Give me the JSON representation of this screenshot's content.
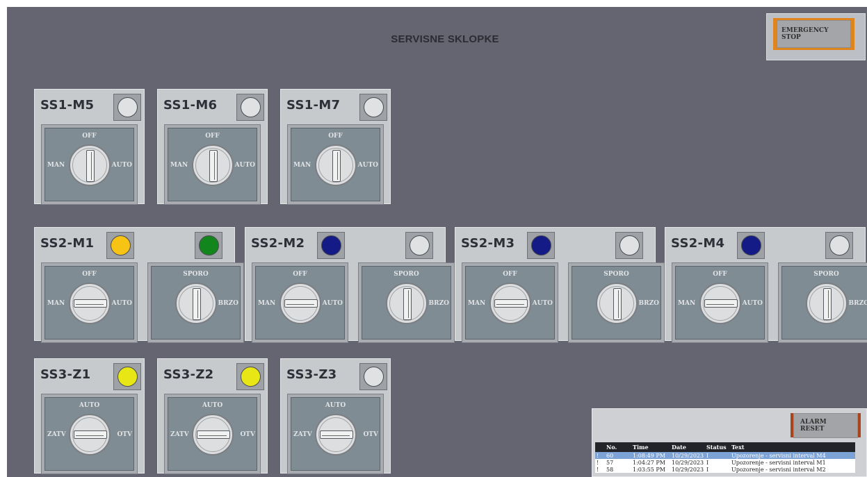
{
  "title": "SERVISNE SKLOPKE",
  "emergency_stop_label": "EMERGENCY STOP",
  "alarm_reset_label": "ALARM RESET",
  "colors": {
    "white_off": "#dfe1e2",
    "yellow_amber": "#f7c416",
    "yellow": "#e9e616",
    "green": "#13851d",
    "blue": "#141a86"
  },
  "row1": [
    {
      "name": "SS1-M5",
      "lamp": "#dfe1e2",
      "sw": {
        "top": "OFF",
        "left": "MAN",
        "right": "AUTO"
      }
    },
    {
      "name": "SS1-M6",
      "lamp": "#dfe1e2",
      "sw": {
        "top": "OFF",
        "left": "MAN",
        "right": "AUTO"
      }
    },
    {
      "name": "SS1-M7",
      "lamp": "#dfe1e2",
      "sw": {
        "top": "OFF",
        "left": "MAN",
        "right": "AUTO"
      }
    }
  ],
  "row2": [
    {
      "name": "SS2-M1",
      "lamp1": "#f7c416",
      "lamp2": "#13851d",
      "sw1": {
        "top": "OFF",
        "left": "MAN",
        "right": "AUTO"
      },
      "sw2": {
        "top": "SPORO",
        "right": "BRZO"
      }
    },
    {
      "name": "SS2-M2",
      "lamp1": "#141a86",
      "lamp2": "#dfe1e2",
      "sw1": {
        "top": "OFF",
        "left": "MAN",
        "right": "AUTO"
      },
      "sw2": {
        "top": "SPORO",
        "right": "BRZO"
      }
    },
    {
      "name": "SS2-M3",
      "lamp1": "#141a86",
      "lamp2": "#dfe1e2",
      "sw1": {
        "top": "OFF",
        "left": "MAN",
        "right": "AUTO"
      },
      "sw2": {
        "top": "SPORO",
        "right": "BRZO"
      }
    },
    {
      "name": "SS2-M4",
      "lamp1": "#141a86",
      "lamp2": "#dfe1e2",
      "sw1": {
        "top": "OFF",
        "left": "MAN",
        "right": "AUTO"
      },
      "sw2": {
        "top": "SPORO",
        "right": "BRZO"
      }
    }
  ],
  "row3": [
    {
      "name": "SS3-Z1",
      "lamp": "#e9e616",
      "sw": {
        "top": "AUTO",
        "left": "ZATV",
        "right": "OTV"
      }
    },
    {
      "name": "SS3-Z2",
      "lamp": "#e9e616",
      "sw": {
        "top": "AUTO",
        "left": "ZATV",
        "right": "OTV"
      }
    },
    {
      "name": "SS3-Z3",
      "lamp": "#dfe1e2",
      "sw": {
        "top": "AUTO",
        "left": "ZATV",
        "right": "OTV"
      }
    }
  ],
  "alarms": {
    "headers": [
      "",
      "No.",
      "Time",
      "Date",
      "Status",
      "Text"
    ],
    "rows": [
      [
        "!",
        "60",
        "1:08:49 PM",
        "10/29/2023",
        "I",
        "Upozorenje - servisni interval M4"
      ],
      [
        "!",
        "57",
        "1:04:27 PM",
        "10/29/2023",
        "I",
        "Upozorenje - servisni interval M1"
      ],
      [
        "!",
        "58",
        "1:03:55 PM",
        "10/29/2023",
        "I",
        "Upozorenje - servisni interval M2"
      ]
    ]
  }
}
